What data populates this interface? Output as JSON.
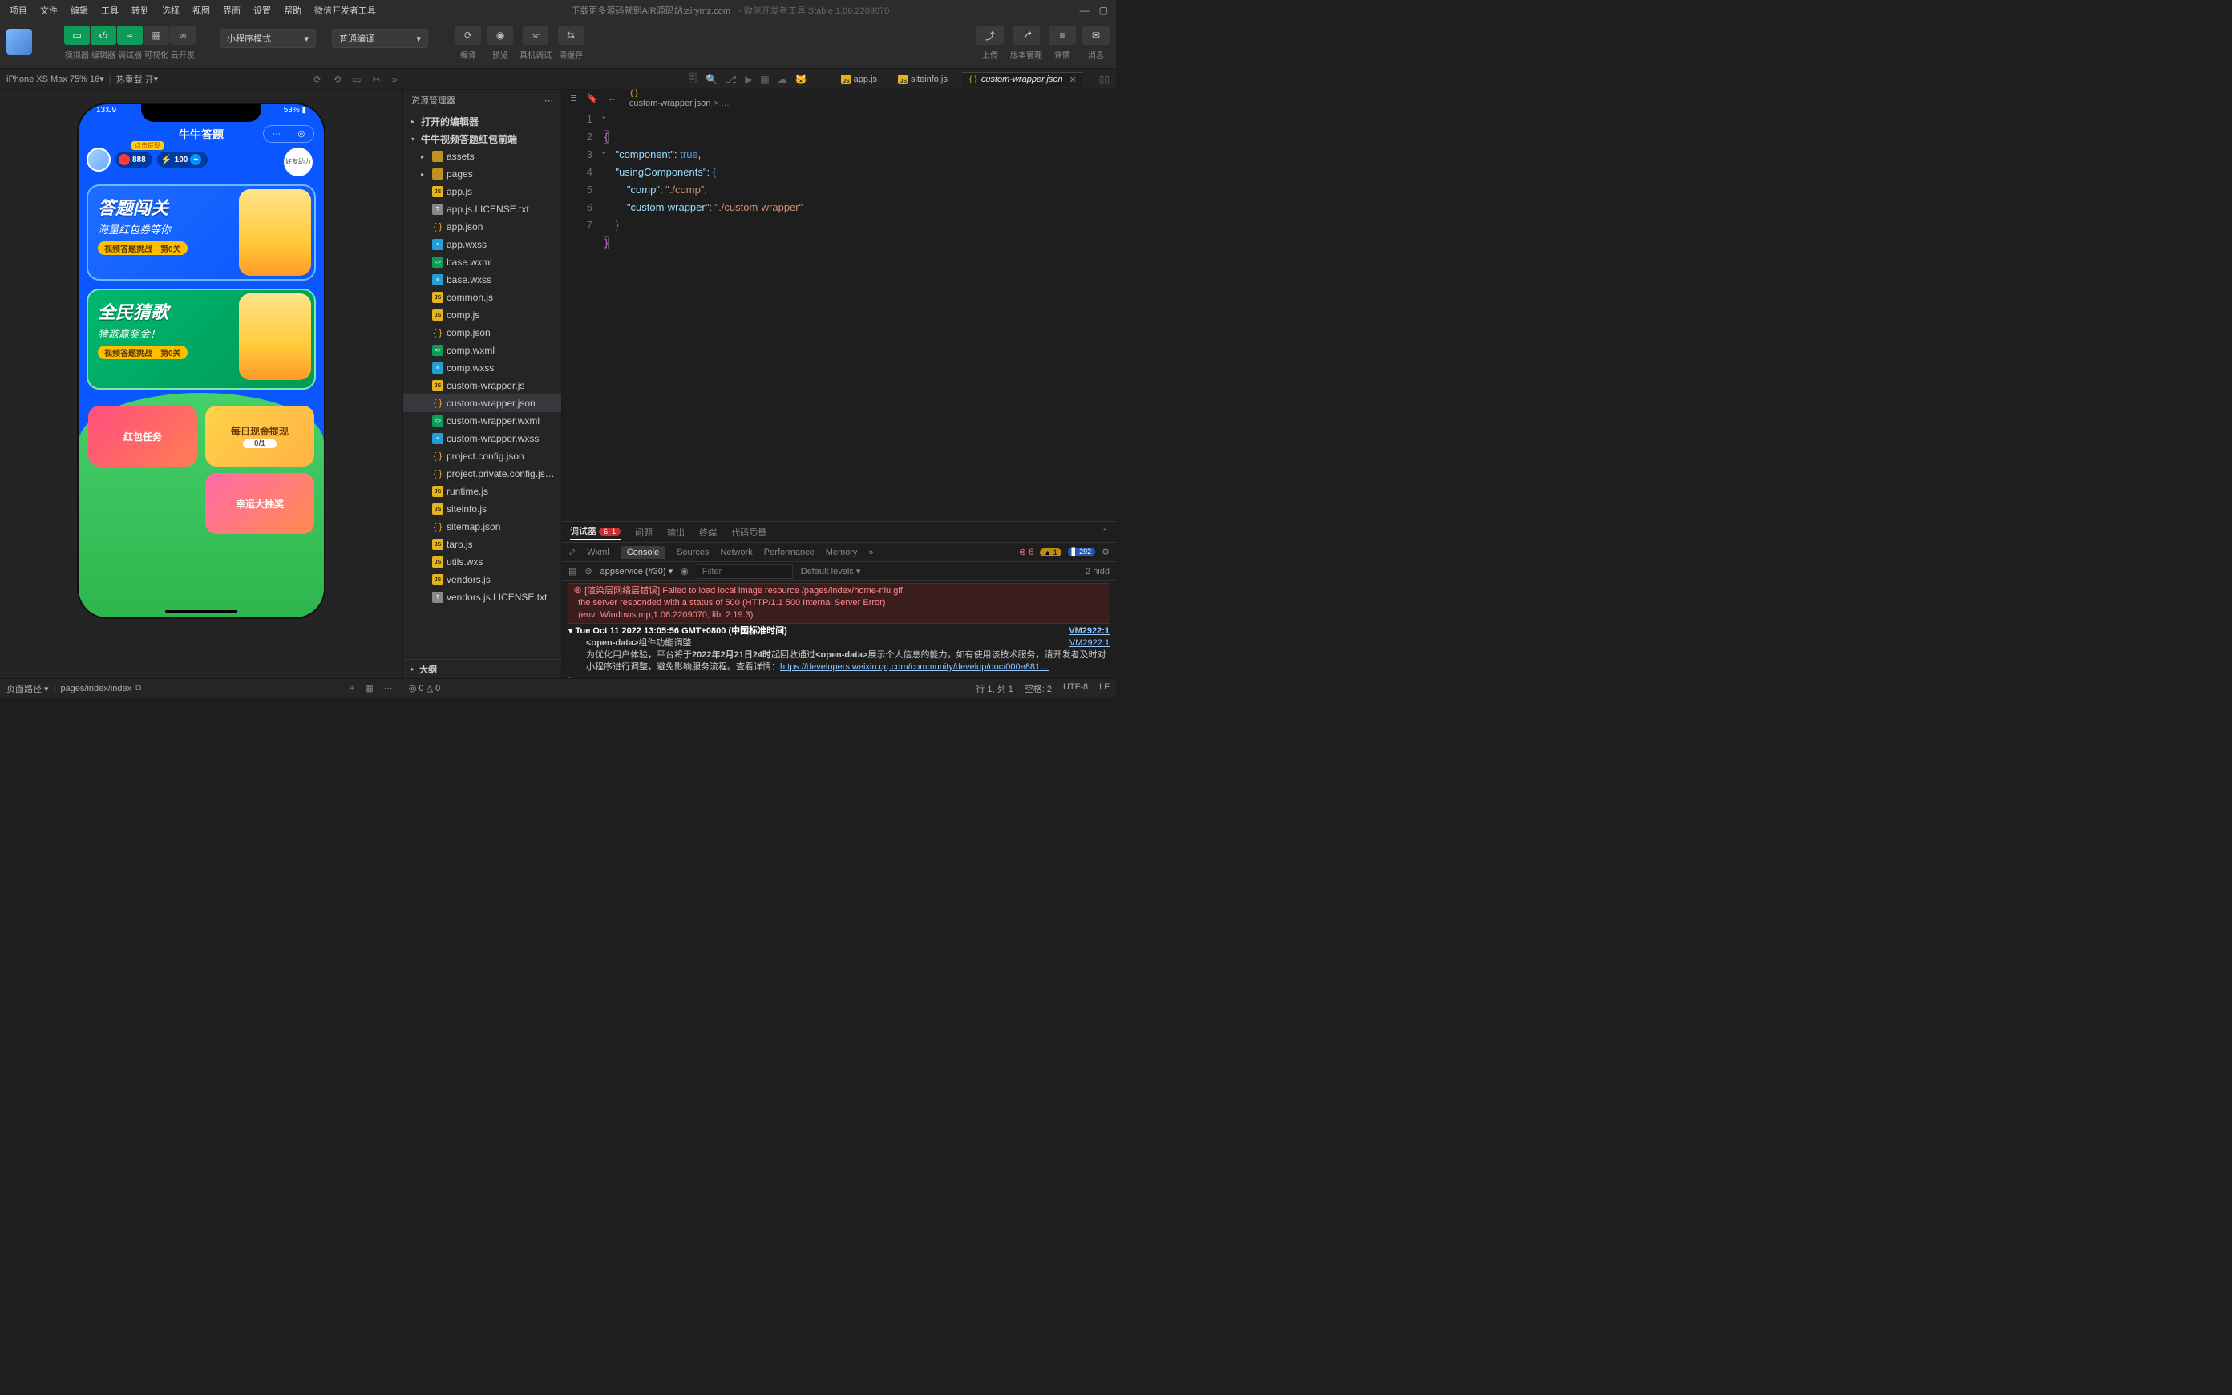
{
  "menu": [
    "项目",
    "文件",
    "编辑",
    "工具",
    "转到",
    "选择",
    "视图",
    "界面",
    "设置",
    "帮助",
    "微信开发者工具"
  ],
  "title_center": "下载更多源码就到AIR源码站:airymz.com",
  "title_suffix": "- 微信开发者工具 Stable 1.06.2209070",
  "toolbar": {
    "groups": [
      {
        "icon": "▭",
        "label": "模拟器"
      },
      {
        "icon": "</>",
        "label": "编辑器"
      },
      {
        "icon": "≈",
        "label": "调试器"
      },
      {
        "icon": "▦",
        "label": "可视化"
      },
      {
        "icon": "∞",
        "label": "云开发"
      }
    ],
    "mode1": "小程序模式",
    "mode2": "普通编译",
    "compile": [
      {
        "icon": "⟳",
        "label": "编译"
      },
      {
        "icon": "◉",
        "label": "预览"
      },
      {
        "icon": "⫘",
        "label": "真机调试"
      },
      {
        "icon": "⇆",
        "label": "清缓存"
      }
    ],
    "right": [
      {
        "icon": "⤴",
        "label": "上传"
      },
      {
        "icon": "⎇",
        "label": "版本管理"
      },
      {
        "icon": "≡",
        "label": "详情"
      },
      {
        "icon": "✉",
        "label": "消息"
      }
    ]
  },
  "simStrip": {
    "device": "iPhone XS Max 75% 16",
    "reload": "热重载 开"
  },
  "tabs": [
    {
      "type": "js",
      "label": "app.js",
      "active": false
    },
    {
      "type": "js",
      "label": "siteinfo.js",
      "active": false
    },
    {
      "type": "json",
      "label": "custom-wrapper.json",
      "active": true
    }
  ],
  "breadcrumb": {
    "file": "custom-wrapper.json",
    "more": "> …"
  },
  "explorer": {
    "header": "资源管理器",
    "roots": [
      {
        "kind": "root",
        "label": "打开的编辑器",
        "expanded": false
      },
      {
        "kind": "root",
        "label": "牛牛视频答题红包前端",
        "expanded": true
      }
    ],
    "files": [
      {
        "icon": "folder",
        "label": "assets",
        "indent": 1,
        "chev": "▸"
      },
      {
        "icon": "folder",
        "label": "pages",
        "indent": 1,
        "chev": "▸"
      },
      {
        "icon": "js",
        "label": "app.js",
        "indent": 1
      },
      {
        "icon": "txt",
        "label": "app.js.LICENSE.txt",
        "indent": 1
      },
      {
        "icon": "json",
        "label": "app.json",
        "indent": 1
      },
      {
        "icon": "css",
        "label": "app.wxss",
        "indent": 1
      },
      {
        "icon": "wxml",
        "label": "base.wxml",
        "indent": 1
      },
      {
        "icon": "css",
        "label": "base.wxss",
        "indent": 1
      },
      {
        "icon": "js",
        "label": "common.js",
        "indent": 1
      },
      {
        "icon": "js",
        "label": "comp.js",
        "indent": 1
      },
      {
        "icon": "json",
        "label": "comp.json",
        "indent": 1
      },
      {
        "icon": "wxml",
        "label": "comp.wxml",
        "indent": 1
      },
      {
        "icon": "css",
        "label": "comp.wxss",
        "indent": 1
      },
      {
        "icon": "js",
        "label": "custom-wrapper.js",
        "indent": 1
      },
      {
        "icon": "json",
        "label": "custom-wrapper.json",
        "indent": 1,
        "sel": true
      },
      {
        "icon": "wxml",
        "label": "custom-wrapper.wxml",
        "indent": 1
      },
      {
        "icon": "css",
        "label": "custom-wrapper.wxss",
        "indent": 1
      },
      {
        "icon": "json",
        "label": "project.config.json",
        "indent": 1
      },
      {
        "icon": "json",
        "label": "project.private.config.js…",
        "indent": 1
      },
      {
        "icon": "js",
        "label": "runtime.js",
        "indent": 1
      },
      {
        "icon": "js",
        "label": "siteinfo.js",
        "indent": 1
      },
      {
        "icon": "json",
        "label": "sitemap.json",
        "indent": 1
      },
      {
        "icon": "js",
        "label": "taro.js",
        "indent": 1
      },
      {
        "icon": "js",
        "label": "utils.wxs",
        "indent": 1
      },
      {
        "icon": "js",
        "label": "vendors.js",
        "indent": 1
      },
      {
        "icon": "txt",
        "label": "vendors.js.LICENSE.txt",
        "indent": 1
      }
    ],
    "outline": "大纲"
  },
  "code": {
    "lines": [
      "1",
      "2",
      "3",
      "4",
      "5",
      "6",
      "7"
    ],
    "l1a": "{",
    "l2a": "\"component\"",
    "l2b": ": ",
    "l2c": "true",
    "l2d": ",",
    "l3a": "\"usingComponents\"",
    "l3b": ": ",
    "l3c": "{",
    "l4a": "\"comp\"",
    "l4b": ": ",
    "l4c": "\"./comp\"",
    "l4d": ",",
    "l5a": "\"custom-wrapper\"",
    "l5b": ": ",
    "l5c": "\"./custom-wrapper\"",
    "l6a": "}",
    "l7a": "}"
  },
  "debug": {
    "tabs": [
      "调试器",
      "问题",
      "输出",
      "终端",
      "代码质量"
    ],
    "badge": "6, 1",
    "toolbarTabs": [
      "Wxml",
      "Console",
      "Sources",
      "Network",
      "Performance",
      "Memory"
    ],
    "errCount": "6",
    "warnCount": "1",
    "infoCount": "292",
    "context": "appservice (#30)",
    "filterPh": "Filter",
    "levels": "Default levels ▾",
    "hidden": "2 hidd",
    "err_title": "[渲染层网络层错误] Failed to load local image resource /pages/index/home-niu.gif",
    "err_l2": "the server responded with a status of 500 (HTTP/1.1 500 Internal Server Error)",
    "err_l3": "(env: Windows,mp,1.06.2209070; lib: 2.19.3)",
    "time": "Tue Oct 11 2022 13:05:56 GMT+0800 (中国标准时间)",
    "vm": "VM2922:1",
    "info1a": "<open-data>",
    "info1b": "组件功能调整",
    "info2_pre": "为优化用户体验，平台将于",
    "info2_b": "2022年2月21日24时",
    "info2_mid": "起回收通过",
    "info2_od": "<open-data>",
    "info2_post": "展示个人信息的能力。如有使用该技术服务，请开发者及时对小程序进行调整，避免影响服务流程。查看详情：",
    "info2_link": "https://developers.weixin.qq.com/community/develop/doc/000e881…",
    "vm2": "VM2922:1"
  },
  "statusbar": {
    "left_label": "页面路径 ▾",
    "path": "pages/index/index",
    "right": [
      "行 1, 列 1",
      "空格: 2",
      "UTF-8",
      "LF"
    ],
    "corner": "◎ 0 △ 0"
  },
  "app": {
    "time": "13:09",
    "battery": "53%",
    "title": "牛牛答题",
    "banner": "点击提现",
    "coin": "888",
    "bolt": "100",
    "friend": "好友助力",
    "card1_title": "答题闯关",
    "card1_sub": "海量红包券等你",
    "card1_tag": "视频答题挑战　第0关",
    "card2_title": "全民猜歌",
    "card2_sub": "猜歌赢奖金！",
    "card2_tag": "视频答题挑战　第0关",
    "sc1": "红包任务",
    "sc2": "每日现金提现",
    "sc2_p": "0/1",
    "sc3": "幸运大抽奖"
  }
}
